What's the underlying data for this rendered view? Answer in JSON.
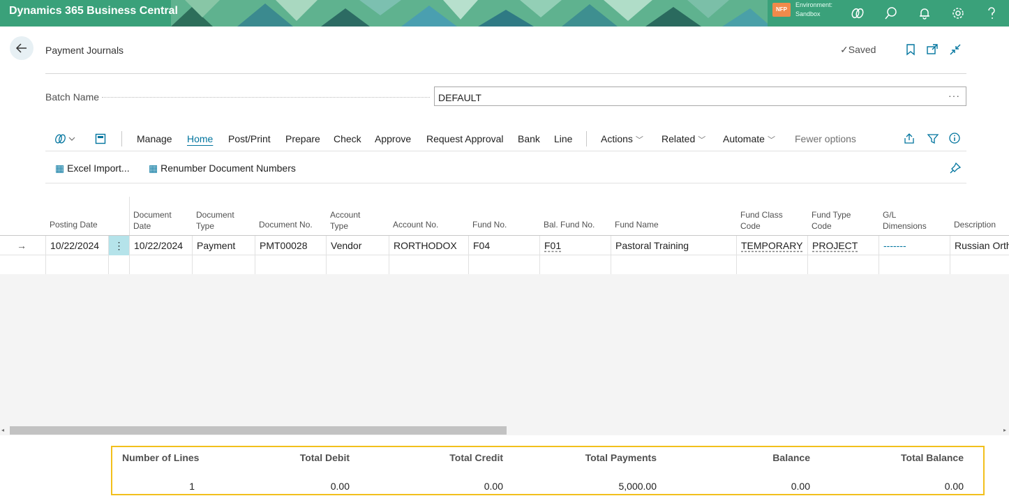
{
  "app": {
    "title": "Dynamics 365 Business Central",
    "company_badge": "NFP",
    "environment_label": "Environment:",
    "environment_name": "Sandbox",
    "brand_color": "#3aa17a"
  },
  "page": {
    "title": "Payment Journals",
    "saved_status": "Saved"
  },
  "batch": {
    "label": "Batch Name",
    "value": "DEFAULT"
  },
  "actions": {
    "tabs": [
      "Manage",
      "Home",
      "Post/Print",
      "Prepare",
      "Check",
      "Approve",
      "Request Approval",
      "Bank",
      "Line"
    ],
    "active_tab": "Home",
    "menus": [
      "Actions",
      "Related",
      "Automate"
    ],
    "fewer_options": "Fewer options",
    "sub_actions": [
      "Excel Import...",
      "Renumber Document Numbers"
    ]
  },
  "grid": {
    "columns": [
      [
        "Posting Date"
      ],
      [
        "Document",
        "Date"
      ],
      [
        "Document",
        "Type"
      ],
      [
        "Document No."
      ],
      [
        "Account",
        "Type"
      ],
      [
        "Account No."
      ],
      [
        "Fund No."
      ],
      [
        "Bal. Fund No."
      ],
      [
        "Fund Name"
      ],
      [
        "Fund Class",
        "Code"
      ],
      [
        "Fund Type",
        "Code"
      ],
      [
        "G/L",
        "Dimensions"
      ],
      [
        "Description"
      ]
    ],
    "rows": [
      {
        "posting_date": "10/22/2024",
        "document_date": "10/22/2024",
        "document_type": "Payment",
        "document_no": "PMT00028",
        "account_type": "Vendor",
        "account_no": "RORTHODOX",
        "fund_no": "F04",
        "bal_fund_no": "F01",
        "fund_name": "Pastoral Training",
        "fund_class_code": "TEMPORARY",
        "fund_type_code": "PROJECT",
        "gl_dimensions": "-------",
        "description": "Russian Orth"
      }
    ]
  },
  "totals": {
    "labels": [
      "Number of Lines",
      "Total Debit",
      "Total Credit",
      "Total Payments",
      "Balance",
      "Total Balance"
    ],
    "values": [
      "1",
      "0.00",
      "0.00",
      "5,000.00",
      "0.00",
      "0.00"
    ]
  }
}
